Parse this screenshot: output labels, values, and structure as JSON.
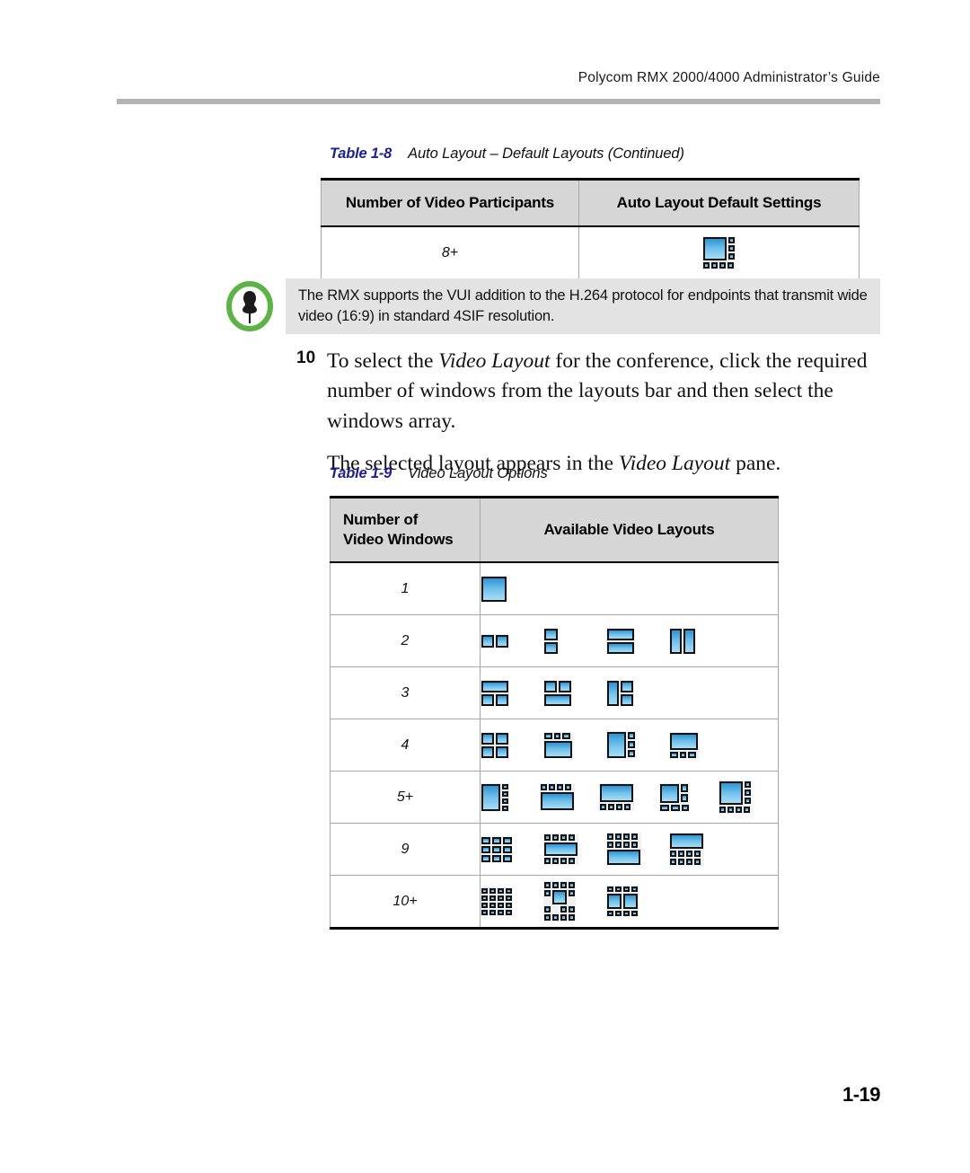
{
  "header": {
    "running_head": "Polycom RMX 2000/4000 Administrator’s Guide"
  },
  "table_1_8": {
    "caption_label": "Table 1-8",
    "caption_text": "Auto Layout – Default Layouts (Continued)",
    "headers": [
      "Number of Video Participants",
      "Auto Layout Default Settings"
    ],
    "rows": [
      {
        "participants": "8+",
        "layout_name": "large-left-3-right-4-bottom"
      }
    ]
  },
  "note": {
    "icon": "pushpin-icon",
    "icon_ring_color": "#5cb447",
    "text": "The RMX supports the VUI addition to the H.264 protocol for endpoints that transmit wide video (16:9) in standard 4SIF resolution."
  },
  "step": {
    "number": "10",
    "text_part1": "To select the ",
    "text_em1": "Video Layout",
    "text_part2": " for the conference, click the required number of windows from the layouts bar and then select the windows array.",
    "follow_part1": "The selected layout appears in the ",
    "follow_em1": "Video Layout",
    "follow_part2": " pane."
  },
  "table_1_9": {
    "caption_label": "Table 1-9",
    "caption_text": "Video Layout Options",
    "headers": {
      "col1_line1": "Number of",
      "col1_line2": "Video Windows",
      "col2": "Available Video Layouts"
    },
    "rows": [
      {
        "windows": "1",
        "layout_names": [
          "single-full"
        ]
      },
      {
        "windows": "2",
        "layout_names": [
          "two-side-by-side-squares",
          "two-stacked-squares",
          "two-stacked-wide",
          "two-side-by-side-tall"
        ]
      },
      {
        "windows": "3",
        "layout_names": [
          "wide-top-two-bottom",
          "two-top-wide-bottom",
          "tall-left-two-right"
        ]
      },
      {
        "windows": "4",
        "layout_names": [
          "grid-2x2",
          "three-small-top-large-bottom",
          "large-left-three-right",
          "large-top-three-bottom"
        ]
      },
      {
        "windows": "5+",
        "layout_names": [
          "large-left-four-right",
          "four-top-large-bottom",
          "large-top-four-bottom",
          "large-two-right-three-bottom",
          "large-three-right-four-bottom"
        ]
      },
      {
        "windows": "9",
        "layout_names": [
          "grid-3x3",
          "four-top-large-mid-four-bottom",
          "eight-top-large-bottom",
          "large-top-eight-bottom"
        ]
      },
      {
        "windows": "10+",
        "layout_names": [
          "grid-4x4",
          "large-center-surround",
          "two-center-surround"
        ]
      }
    ]
  },
  "footer": {
    "page_number": "1-19"
  },
  "colors": {
    "caption_blue": "#1f1f8f",
    "header_fill": "#d6d6d6",
    "note_fill": "#e3e3e3",
    "rule_gray": "#b3b3b3",
    "pane_blue_top": "#2f93d4",
    "pane_blue_bottom": "#a9dcf5"
  }
}
